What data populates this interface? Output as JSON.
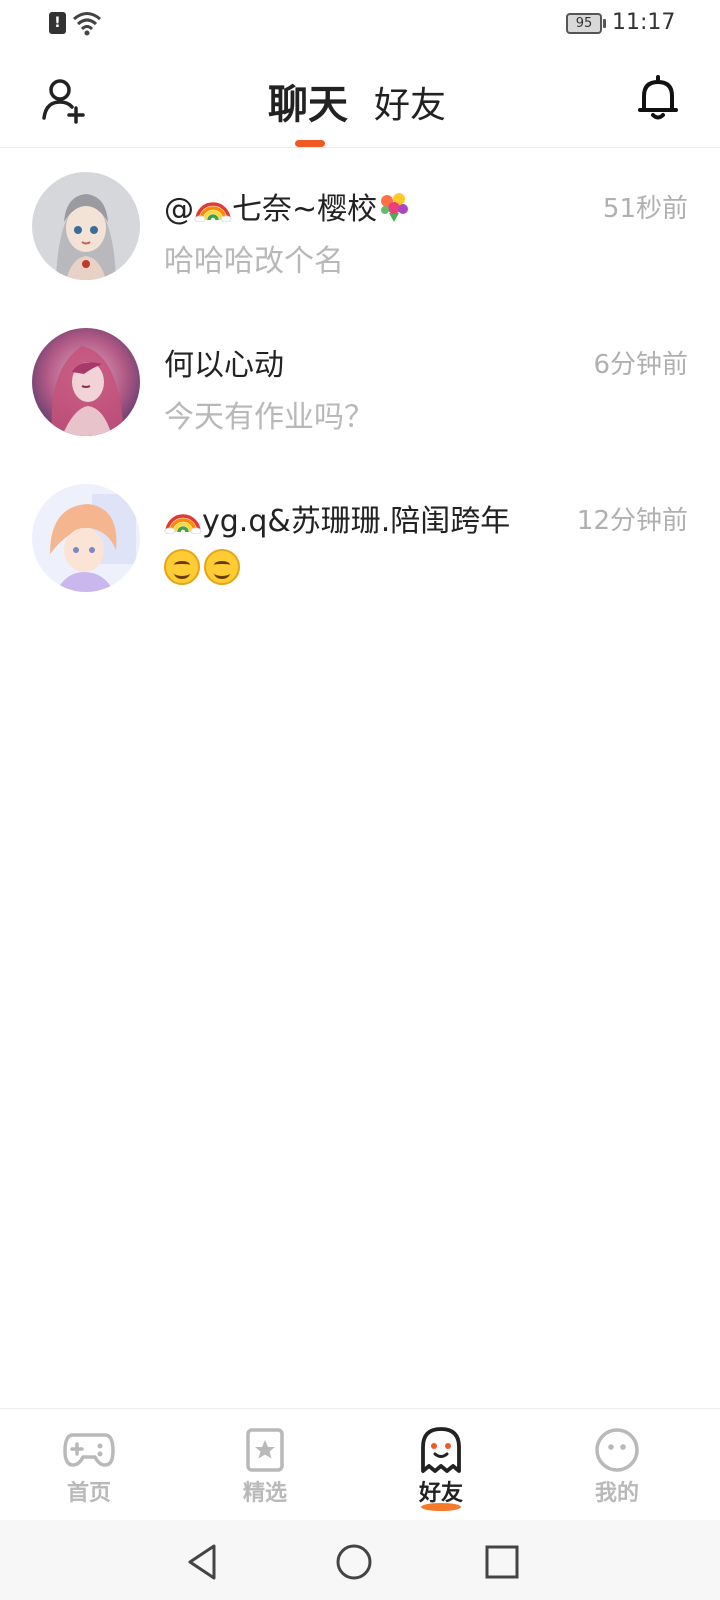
{
  "status_bar": {
    "alert_glyph": "!",
    "battery": "95",
    "time": "11:17"
  },
  "header": {
    "tabs": [
      {
        "label": "聊天",
        "active": true
      },
      {
        "label": "好友",
        "active": false
      }
    ],
    "left_icon": "add-friend-icon",
    "right_icon": "bell-icon",
    "accent_color": "#f05a22"
  },
  "chats": [
    {
      "name_prefix": "@",
      "name_main": "七奈~樱校",
      "time": "51秒前",
      "message": "哈哈哈改个名"
    },
    {
      "name": "何以心动",
      "time": "6分钟前",
      "message": "今天有作业吗？"
    },
    {
      "name_main": "yg.q&苏珊珊.陪闺跨年",
      "time": "12分钟前",
      "message_emojis": [
        "smiling-face",
        "smiling-face"
      ]
    }
  ],
  "bottom_nav": [
    {
      "label": "首页",
      "icon": "gamepad-icon",
      "active": false
    },
    {
      "label": "精选",
      "icon": "star-card-icon",
      "active": false
    },
    {
      "label": "好友",
      "icon": "ghost-icon",
      "active": true
    },
    {
      "label": "我的",
      "icon": "face-icon",
      "active": false
    }
  ]
}
